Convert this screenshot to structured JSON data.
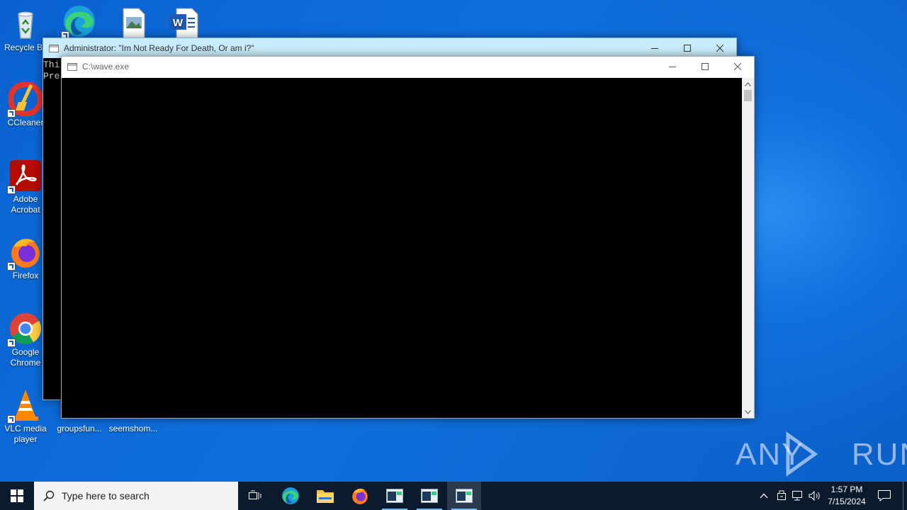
{
  "desktop": {
    "icons": [
      {
        "label": "Recycle Bin"
      },
      {
        "label": ""
      },
      {
        "label": ""
      },
      {
        "label": ""
      },
      {
        "label": "CCleaner"
      },
      {
        "label": "Adobe Acrobat"
      },
      {
        "label": "Firefox"
      },
      {
        "label": "Google Chrome"
      },
      {
        "label": "VLC media player"
      },
      {
        "label": "groupsfun..."
      },
      {
        "label": "seemshom..."
      }
    ]
  },
  "back_window": {
    "title": "Administrator:  \"Im Not Ready For Death, Or am i?\"",
    "console_lines": [
      "Thi",
      "Pre"
    ]
  },
  "front_window": {
    "title": "C:\\wave.exe"
  },
  "taskbar": {
    "search_placeholder": "Type here to search",
    "time": "1:57 PM",
    "date": "7/15/2024"
  },
  "watermark": {
    "text": "ANY RUN"
  }
}
